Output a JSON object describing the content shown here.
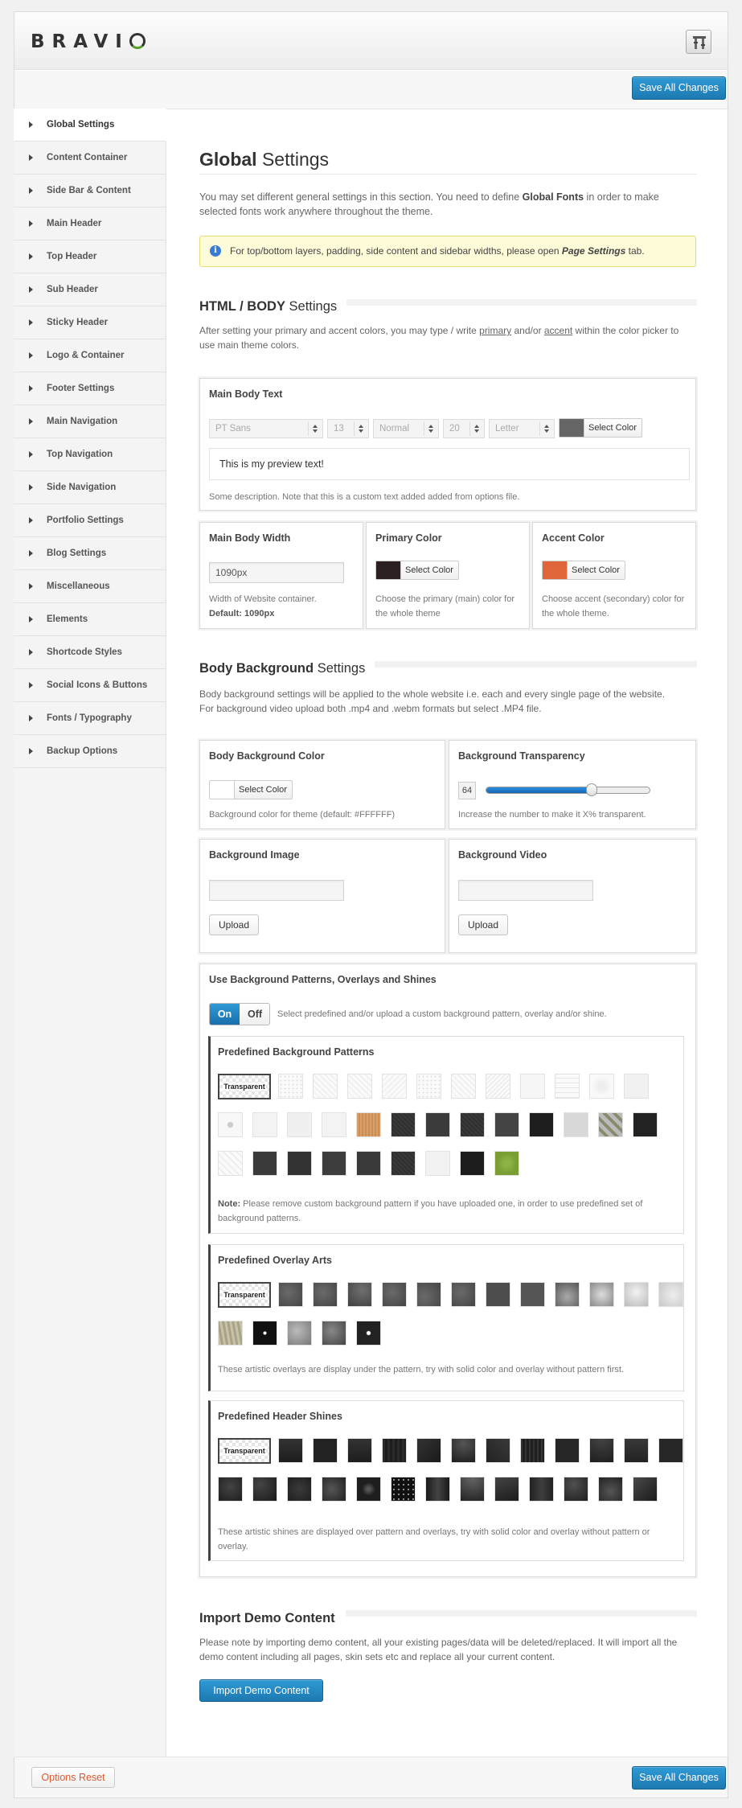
{
  "header": {
    "logo": "BRAVI",
    "save_label": "Save All Changes"
  },
  "sidebar": {
    "items": [
      {
        "label": "Global Settings"
      },
      {
        "label": "Content Container"
      },
      {
        "label": "Side Bar & Content"
      },
      {
        "label": "Main Header"
      },
      {
        "label": "Top Header"
      },
      {
        "label": "Sub Header"
      },
      {
        "label": "Sticky Header"
      },
      {
        "label": "Logo & Container"
      },
      {
        "label": "Footer Settings"
      },
      {
        "label": "Main Navigation"
      },
      {
        "label": "Top Navigation"
      },
      {
        "label": "Side Navigation"
      },
      {
        "label": "Portfolio Settings"
      },
      {
        "label": "Blog Settings"
      },
      {
        "label": "Miscellaneous"
      },
      {
        "label": "Elements"
      },
      {
        "label": "Shortcode Styles"
      },
      {
        "label": "Social Icons & Buttons"
      },
      {
        "label": "Fonts / Typography"
      },
      {
        "label": "Backup Options"
      }
    ]
  },
  "page": {
    "title_bold": "Global",
    "title_rest": " Settings",
    "intro_1": "You may set different general settings in this section. You need to define ",
    "intro_bold": "Global Fonts",
    "intro_2": " in order to make selected fonts work anywhere throughout the theme.",
    "notice_1": "For top/bottom layers, padding, side content and sidebar widths, please open ",
    "notice_em": "Page Settings",
    "notice_2": " tab."
  },
  "html_body": {
    "title_bold": "HTML / BODY",
    "title_rest": " Settings",
    "desc_1": "After setting your primary and accent colors, you may type / write ",
    "desc_primary": "primary",
    "desc_2": " and/or ",
    "desc_accent": "accent",
    "desc_3": " within the color picker to use main theme colors.",
    "main_body_text": {
      "title": "Main Body Text",
      "font": "PT Sans",
      "size": "13",
      "weight": "Normal",
      "line_height": "20",
      "transform": "Letter",
      "color_label": "Select Color",
      "color": "#666666",
      "preview": "This is my preview text!",
      "desc": "Some description. Note that this is a custom text added added from options file."
    },
    "main_body_width": {
      "title": "Main Body Width",
      "value": "1090px",
      "desc": "Width of Website container.",
      "default": "Default: 1090px"
    },
    "primary_color": {
      "title": "Primary Color",
      "label": "Select Color",
      "color": "#2d2020",
      "desc": "Choose the primary (main) color for the whole theme"
    },
    "accent_color": {
      "title": "Accent Color",
      "label": "Select Color",
      "color": "#e0653a",
      "desc": "Choose accent (secondary) color for the whole theme."
    }
  },
  "body_bg": {
    "title_bold": "Body Background",
    "title_rest": " Settings",
    "desc": "Body background settings will be applied to the whole website i.e. each and every single page of the website. For background video upload both .mp4 and .webm formats but select .MP4 file.",
    "bg_color": {
      "title": "Body Background Color",
      "label": "Select Color",
      "color": "#ffffff",
      "desc": "Background color for theme (default: #FFFFFF)"
    },
    "transparency": {
      "title": "Background Transparency",
      "value": "64",
      "level": 0.64,
      "desc": "Increase the number to make it X% transparent."
    },
    "bg_image": {
      "title": "Background Image",
      "upload": "Upload"
    },
    "bg_video": {
      "title": "Background Video",
      "upload": "Upload"
    },
    "patterns": {
      "title": "Use Background Patterns, Overlays and Shines",
      "on": "On",
      "off": "Off",
      "toggle_desc": "Select predefined and/or upload a custom background pattern, overlay and/or shine.",
      "predefined_patterns": {
        "title": "Predefined Background Patterns",
        "transparent": "Transparent",
        "note_bold": "Note:",
        "note": " Please remove custom background pattern if you have uploaded one, in order to use predefined set of background patterns."
      },
      "overlay_arts": {
        "title": "Predefined Overlay Arts",
        "transparent": "Transparent",
        "desc": "These artistic overlays are display under the pattern, try with solid color and overlay without pattern first."
      },
      "header_shines": {
        "title": "Predefined Header Shines",
        "transparent": "Transparent",
        "desc": "These artistic shines are displayed over pattern and overlays, try with solid color and overlay without pattern or overlay."
      }
    }
  },
  "import_demo": {
    "title": "Import Demo Content",
    "desc": "Please note by importing demo content, all your existing pages/data will be deleted/replaced. It will import all the demo content including all pages, skin sets etc and replace all your current content.",
    "button": "Import Demo Content"
  },
  "footer": {
    "reset": "Options Reset",
    "save_label": "Save All Changes"
  }
}
